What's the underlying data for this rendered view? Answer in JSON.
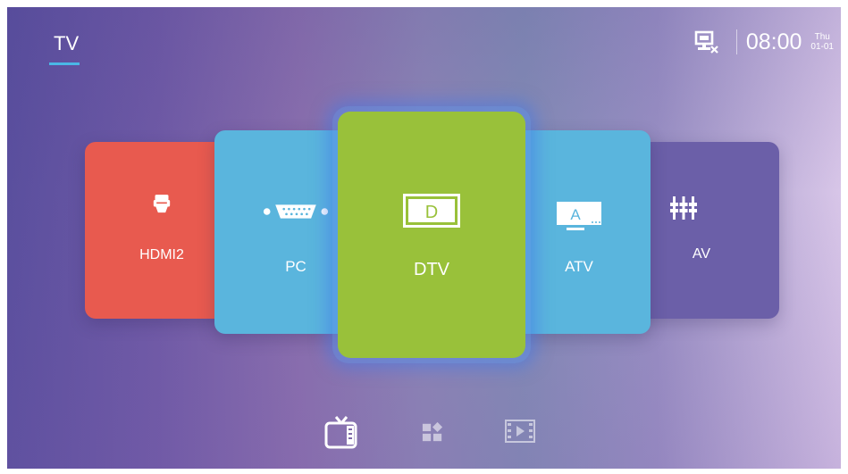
{
  "header": {
    "tab_label": "TV",
    "time": "08:00",
    "day": "Thu",
    "date": "01-01",
    "network_icon": "network-disconnected-icon"
  },
  "sources": [
    {
      "label": "HDMI2",
      "icon": "hdmi-icon",
      "color": "#e85a4f"
    },
    {
      "label": "PC",
      "icon": "vga-icon",
      "color": "#5ab5dd"
    },
    {
      "label": "DTV",
      "icon": "dtv-icon",
      "icon_letter": "D",
      "color": "#99c13a",
      "selected": true
    },
    {
      "label": "ATV",
      "icon": "atv-icon",
      "icon_letter": "A",
      "color": "#5ab5dd"
    },
    {
      "label": "AV",
      "icon": "av-icon",
      "color": "#6b5fa8"
    }
  ],
  "bottom_nav": [
    {
      "icon": "tv-icon",
      "active": true
    },
    {
      "icon": "apps-icon",
      "active": false
    },
    {
      "icon": "media-icon",
      "active": false
    }
  ],
  "colors": {
    "accent": "#4ab7e6",
    "selected_glow": "#4f86e0"
  }
}
